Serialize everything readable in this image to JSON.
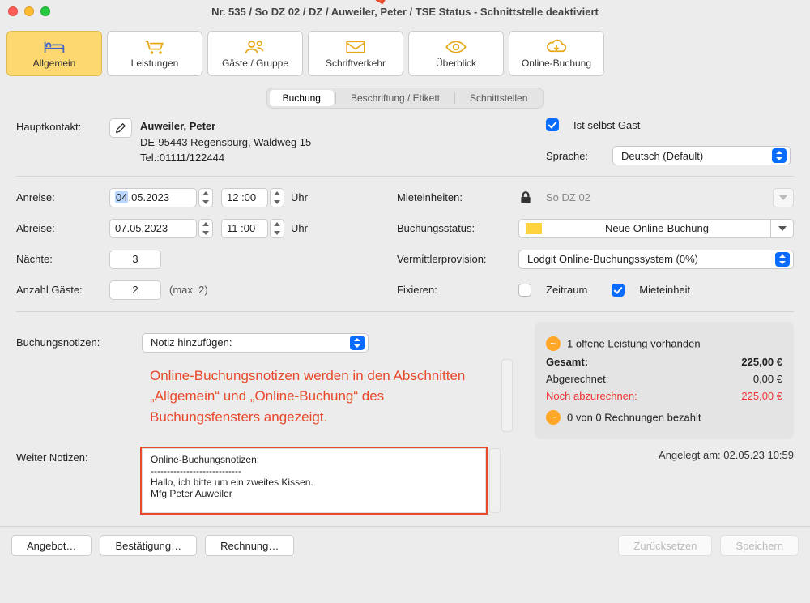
{
  "window": {
    "title": "Nr. 535 / So DZ 02 / DZ / Auweiler, Peter / TSE Status - Schnittstelle deaktiviert"
  },
  "toolbar": [
    {
      "label": "Allgemein",
      "icon": "bed-icon",
      "active": true
    },
    {
      "label": "Leistungen",
      "icon": "cart-icon",
      "active": false
    },
    {
      "label": "Gäste / Gruppe",
      "icon": "guests-icon",
      "active": false
    },
    {
      "label": "Schriftverkehr",
      "icon": "mail-icon",
      "active": false
    },
    {
      "label": "Überblick",
      "icon": "eye-icon",
      "active": false
    },
    {
      "label": "Online-Buchung",
      "icon": "cloud-download-icon",
      "active": false
    }
  ],
  "tabs": [
    {
      "label": "Buchung",
      "active": true
    },
    {
      "label": "Beschriftung / Etikett",
      "active": false
    },
    {
      "label": "Schnittstellen",
      "active": false
    }
  ],
  "labels": {
    "hauptkontakt": "Hauptkontakt:",
    "ist_selbst_gast": "Ist selbst Gast",
    "sprache": "Sprache:",
    "anreise": "Anreise:",
    "abreise": "Abreise:",
    "uhr": "Uhr",
    "naechte": "Nächte:",
    "anzahl_gaeste": "Anzahl Gäste:",
    "max": "(max. 2)",
    "mieteinheiten": "Mieteinheiten:",
    "buchungsstatus": "Buchungsstatus:",
    "vermittlerprovision": "Vermittlerprovision:",
    "fixieren": "Fixieren:",
    "zeitraum": "Zeitraum",
    "mieteinheit": "Mieteinheit",
    "buchungsnotizen": "Buchungsnotizen:",
    "weiter_notizen": "Weiter Notizen:",
    "notiz_hinzu": "Notiz hinzufügen:"
  },
  "contact": {
    "name": "Auweiler, Peter",
    "addr": "DE-95443 Regensburg, Waldweg 15",
    "tel": "Tel.:01111/122444"
  },
  "language": "Deutsch (Default)",
  "arrival": {
    "date": "04.05.2023",
    "date_hl_part": "04",
    "date_rest": ".05.2023",
    "time": "12 :00"
  },
  "departure": {
    "date": "07.05.2023",
    "time": "11 :00"
  },
  "nights": "3",
  "guests": "2",
  "unit": "So DZ 02",
  "status": "Neue Online-Buchung",
  "provision": "Lodgit Online-Buchungssystem (0%)",
  "fix_zeitraum": false,
  "fix_mieteinheit": true,
  "callout": "Online-Buchungsnotizen werden in den Abschnitten „Allgemein“ und „Online-Buchung“ des Buchungsfensters angezeigt.",
  "weiter_text": "Online-Buchungsnotizen:\n----------------------------\nHallo, ich bitte um ein zweites Kissen.\nMfg Peter Auweiler",
  "summary": {
    "open_service": "1 offene Leistung vorhanden",
    "gesamt_lbl": "Gesamt:",
    "gesamt_val": "225,00 €",
    "abg_lbl": "Abgerechnet:",
    "abg_val": "0,00 €",
    "noch_lbl": "Noch abzurechnen:",
    "noch_val": "225,00 €",
    "rech": "0 von 0 Rechnungen bezahlt",
    "angelegt": "Angelegt am: 02.05.23 10:59"
  },
  "footer": {
    "angebot": "Angebot…",
    "bestaetigung": "Bestätigung…",
    "rechnung": "Rechnung…",
    "zuruecksetzen": "Zurücksetzen",
    "speichern": "Speichern"
  }
}
